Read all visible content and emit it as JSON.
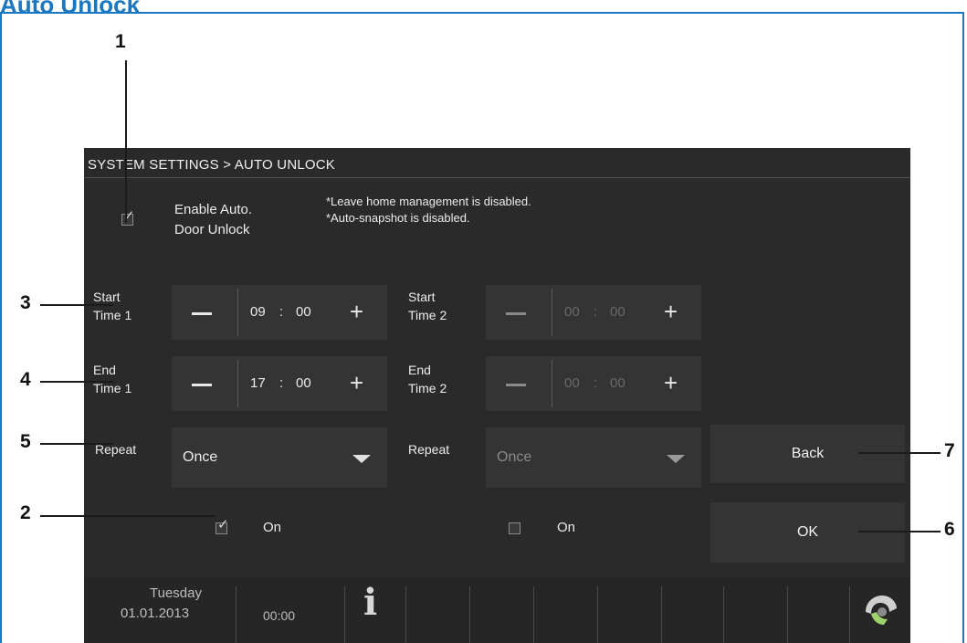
{
  "doc_title": "Auto Unlock",
  "screen": {
    "breadcrumb": "SYSTEM SETTINGS > AUTO UNLOCK",
    "enable": {
      "checked": true,
      "label_line1": "Enable Auto.",
      "label_line2": "Door Unlock",
      "note1": "*Leave home management is disabled.",
      "note2": "*Auto-snapshot is disabled."
    },
    "schedule1": {
      "start_label_line1": "Start",
      "start_label_line2": "Time 1",
      "start_hour": "09",
      "start_min": "00",
      "end_label_line1": "End",
      "end_label_line2": "Time 1",
      "end_hour": "17",
      "end_min": "00",
      "repeat_label": "Repeat",
      "repeat_value": "Once",
      "on_checked": true,
      "on_label": "On"
    },
    "schedule2": {
      "start_label_line1": "Start",
      "start_label_line2": "Time 2",
      "start_hour": "00",
      "start_min": "00",
      "end_label_line1": "End",
      "end_label_line2": "Time 2",
      "end_hour": "00",
      "end_min": "00",
      "repeat_label": "Repeat",
      "repeat_value": "Once",
      "on_checked": false,
      "on_label": "On"
    },
    "colon": ":",
    "minus_symbol": "—",
    "plus_symbol": "+",
    "back_label": "Back",
    "ok_label": "OK",
    "status": {
      "day": "Tuesday",
      "date": "01.01.2013",
      "time": "00:00",
      "info_icon": "i"
    }
  },
  "callouts": {
    "c1": "1",
    "c2": "2",
    "c3": "3",
    "c4": "4",
    "c5": "5",
    "c6": "6",
    "c7": "7"
  },
  "colors": {
    "frame_blue": "#1a78c2",
    "screen_bg": "#2a2a2a",
    "field_bg": "#343434"
  }
}
